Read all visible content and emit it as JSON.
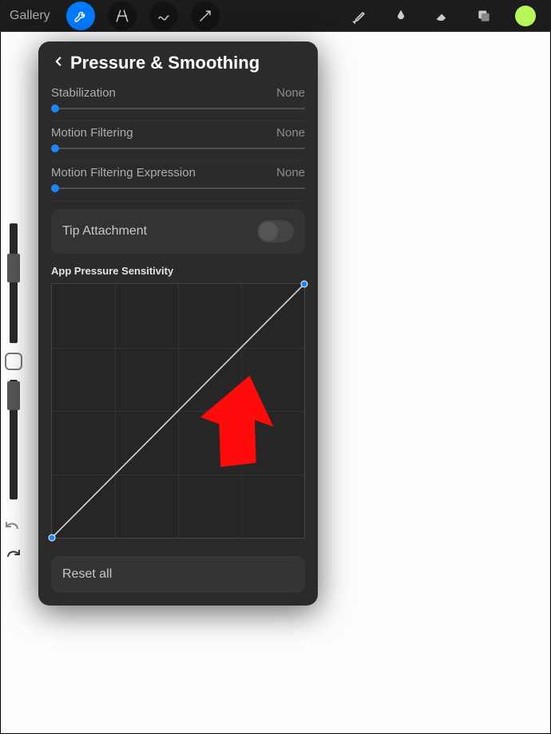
{
  "toolbar": {
    "gallery_label": "Gallery"
  },
  "popover": {
    "title": "Pressure & Smoothing",
    "sliders": [
      {
        "label": "Stabilization",
        "value": "None"
      },
      {
        "label": "Motion Filtering",
        "value": "None"
      },
      {
        "label": "Motion Filtering Expression",
        "value": "None"
      }
    ],
    "tip_attachment_label": "Tip Attachment",
    "curve_title": "App Pressure Sensitivity",
    "reset_label": "Reset all"
  },
  "colors": {
    "accent": "#007aff",
    "swatch": "#b8f55b",
    "annotation": "#ff0000"
  }
}
